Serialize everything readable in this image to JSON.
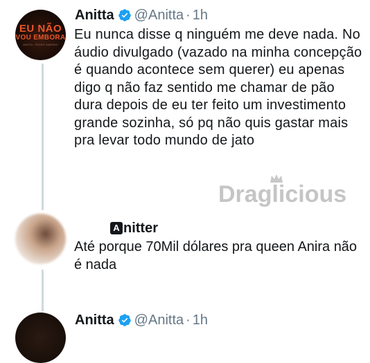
{
  "tweet": {
    "name": "Anitta",
    "handle": "@Anitta",
    "separator": "·",
    "time": "1h",
    "avatar_text": [
      "EU NÃO",
      "VOU EMBORA",
      "ANITTA · PEDRO SAMPAIO"
    ],
    "text": "Eu nunca disse q ninguém me deve nada. No áudio divulgado (vazado na minha concepção é quando acontece sem querer) eu apenas digo q não faz sentido me chamar de pão dura depois de eu ter feito um investimento grande sozinha, só pq não quis gastar mais pra levar todo mundo de jato"
  },
  "watermark": "Draglicious",
  "reply": {
    "icon_letter": "A",
    "name": "nitter",
    "text": "Até porque 70Mil dólares pra queen Anira não é nada"
  },
  "next_tweet": {
    "name": "Anitta",
    "handle": "@Anitta",
    "separator": "·",
    "time": "1h"
  },
  "colors": {
    "verified": "#1da1f2",
    "secondary_text": "#657786",
    "thread_line": "#cfd9de"
  }
}
